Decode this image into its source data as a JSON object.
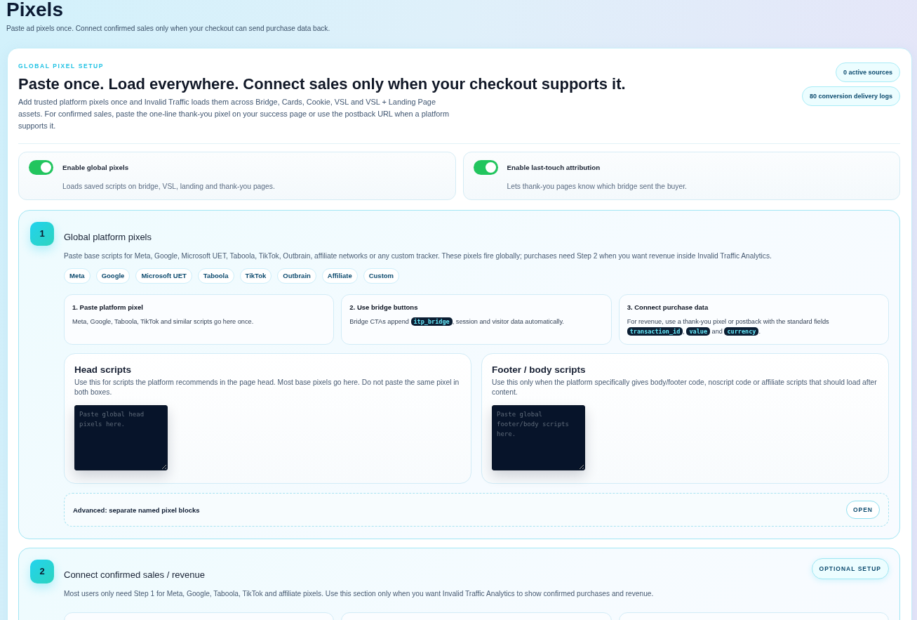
{
  "page": {
    "title": "Pixels",
    "subtitle": "Paste ad pixels once. Connect confirmed sales only when your checkout can send purchase data back."
  },
  "setup": {
    "eyebrow": "GLOBAL PIXEL SETUP",
    "heading": "Paste once. Load everywhere. Connect sales only when your checkout supports it.",
    "description": "Add trusted platform pixels once and Invalid Traffic loads them across Bridge, Cards, Cookie, VSL and VSL + Landing Page assets. For confirmed sales, paste the one-line thank-you pixel on your success page or use the postback URL when a platform supports it.",
    "badges": [
      "0 active sources",
      "80 conversion delivery logs"
    ]
  },
  "toggles": [
    {
      "label": "Enable global pixels",
      "description": "Loads saved scripts on bridge, VSL, landing and thank-you pages.",
      "on": true
    },
    {
      "label": "Enable last-touch attribution",
      "description": "Lets thank-you pages know which bridge sent the buyer.",
      "on": true
    }
  ],
  "steps": [
    {
      "kind": "pixels",
      "number": "1",
      "title": "Global platform pixels",
      "description": "Paste base scripts for Meta, Google, Microsoft UET, Taboola, TikTok, Outbrain, affiliate networks or any custom tracker. These pixels fire globally; purchases need Step 2 when you want revenue inside Invalid Traffic Analytics.",
      "platforms": [
        "Meta",
        "Google",
        "Microsoft UET",
        "Taboola",
        "TikTok",
        "Outbrain",
        "Affiliate",
        "Custom"
      ],
      "info_cards": [
        {
          "title": "1. Paste platform pixel",
          "text": [
            {
              "kind": "text",
              "text": "Meta, Google, Taboola, TikTok and similar scripts go here once."
            }
          ]
        },
        {
          "title": "2. Use bridge buttons",
          "text": [
            {
              "kind": "text",
              "text": "Bridge CTAs append "
            },
            {
              "kind": "code",
              "text": "itp_bridge"
            },
            {
              "kind": "text",
              "text": ", session and visitor data automatically."
            }
          ]
        },
        {
          "title": "3. Connect purchase data",
          "text": [
            {
              "kind": "text",
              "text": "For revenue, use a thank-you pixel or postback with the standard fields "
            },
            {
              "kind": "code",
              "text": "transaction_id"
            },
            {
              "kind": "text",
              "text": ", "
            },
            {
              "kind": "code",
              "text": "value"
            },
            {
              "kind": "text",
              "text": " and "
            },
            {
              "kind": "code",
              "text": "currency"
            },
            {
              "kind": "text",
              "text": "."
            }
          ]
        }
      ],
      "script_boxes": [
        {
          "title": "Head scripts",
          "description": "Use this for scripts the platform recommends in the page head. Most base pixels go here. Do not paste the same pixel in both boxes.",
          "placeholder": "Paste global head pixels here."
        },
        {
          "title": "Footer / body scripts",
          "description": "Use this only when the platform specifically gives body/footer code, noscript code or affiliate scripts that should load after content.",
          "placeholder": "Paste global footer/body scripts here."
        }
      ],
      "advanced": {
        "label": "Advanced: separate named pixel blocks",
        "button": "OPEN"
      }
    },
    {
      "kind": "revenue",
      "number": "2",
      "title": "Connect confirmed sales / revenue",
      "action": "OPTIONAL SETUP",
      "description": "Most users only need Step 1 for Meta, Google, Taboola, TikTok and affiliate pixels. Use this section only when you want Invalid Traffic Analytics to show confirmed purchases and revenue."
    }
  ]
}
